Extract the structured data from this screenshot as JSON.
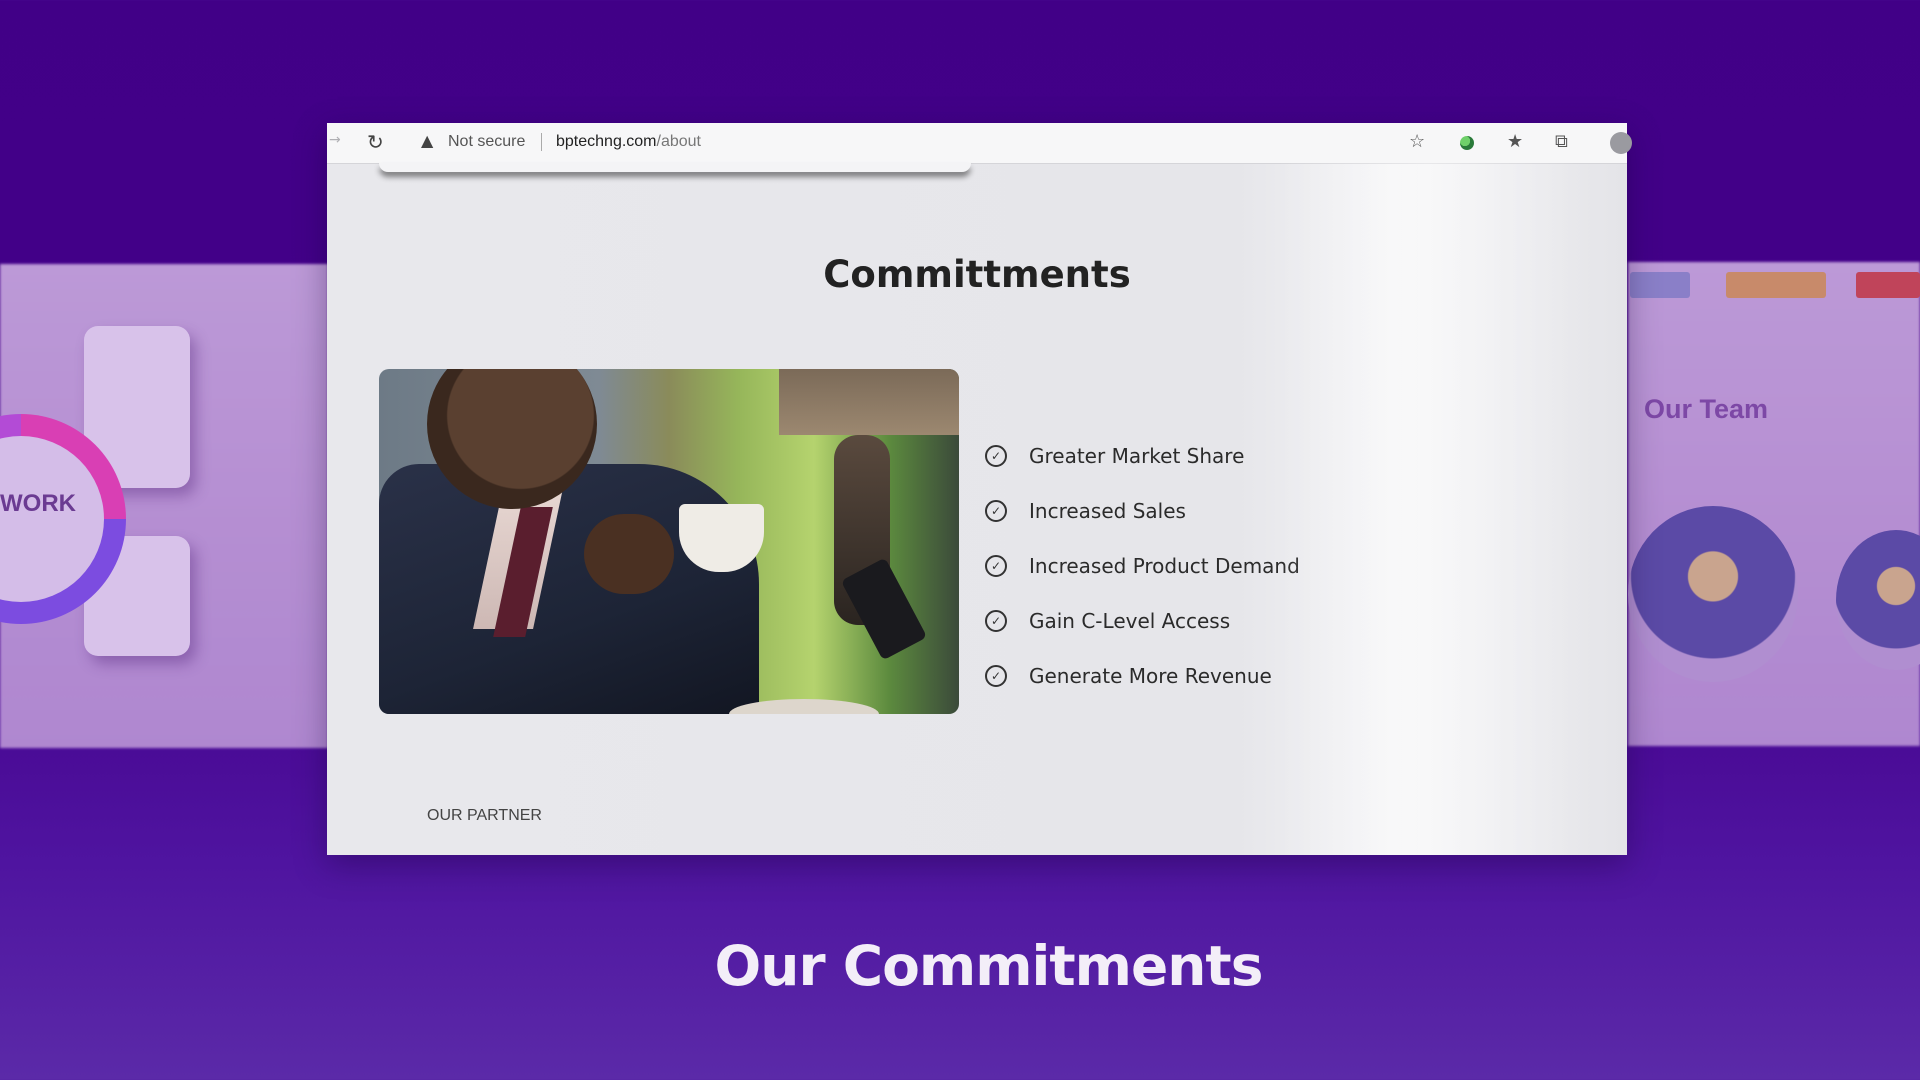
{
  "browser": {
    "security_label": "Not secure",
    "url_domain": "bptechng.com",
    "url_path": "/about"
  },
  "page": {
    "heading": "Committments",
    "commitments": [
      "Greater Market Share",
      "Increased Sales",
      "Increased Product Demand",
      "Gain C-Level Access",
      "Generate More Revenue"
    ],
    "partner_label": "OUR PARTNER"
  },
  "background": {
    "left_panel_label": "WORK",
    "right_panel_title": "Our Team"
  },
  "caption": "Our Commitments",
  "colors": {
    "backdrop_purple": "#410087",
    "caption_text": "#f3eef8",
    "heading_text": "#222222"
  }
}
